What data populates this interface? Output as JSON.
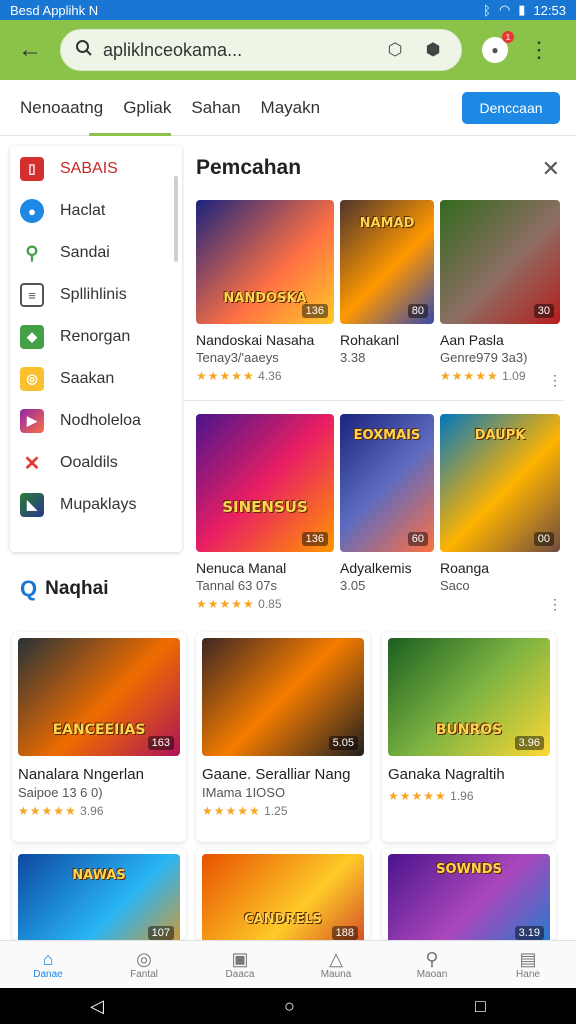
{
  "status": {
    "left": "Besd Applihk  N",
    "time": "12:53"
  },
  "topbar": {
    "search_value": "apliklnceokama..."
  },
  "tabs": {
    "items": [
      "Nenoaatng",
      "Gpliak",
      "Sahan",
      "Mayakn"
    ],
    "button": "Denccaan"
  },
  "sidebar": {
    "items": [
      {
        "label": "SABAIS",
        "color": "#d32f2f",
        "icon": "phone"
      },
      {
        "label": "Haclat",
        "color": "#1e88e5",
        "icon": "location"
      },
      {
        "label": "Sandai",
        "color": "#43a047",
        "icon": "search"
      },
      {
        "label": "Spllihlinis",
        "color": "#555555",
        "icon": "document"
      },
      {
        "label": "Renorgan",
        "color": "#43a047",
        "icon": "tag"
      },
      {
        "label": "Saakan",
        "color": "#fbc02d",
        "icon": "coin"
      },
      {
        "label": "Nodholeloa",
        "color": "#8e24aa",
        "icon": "play"
      },
      {
        "label": "Ooaldils",
        "color": "#e53935",
        "icon": "tools"
      },
      {
        "label": "Mupaklays",
        "color": "#2e7d32",
        "icon": "flag"
      }
    ]
  },
  "panel": {
    "title": "Pemcahan",
    "row1": [
      {
        "name": "Nandoskai Nasaha",
        "sub": "Tenay3/'aaeys",
        "rating": "4.36",
        "badge": "136",
        "art": "NANDOSKA",
        "bg": "linear-gradient(135deg,#1a237e,#ff7043 60%,#ffca28)"
      },
      {
        "name": "Rohakanl",
        "sub": "3.38",
        "rating": "",
        "badge": "80",
        "art": "NAMAD",
        "bg": "linear-gradient(135deg,#4e342e,#ff9800 55%,#3949ab)"
      },
      {
        "name": "Aan Pasla",
        "sub": "Genre979 3a3)",
        "rating": "1.09",
        "badge": "30",
        "art": "",
        "bg": "linear-gradient(135deg,#33691e,#8d6e63 55%,#b71c1c)"
      }
    ],
    "row2": [
      {
        "name": "Nenuca Manal",
        "sub": "Tannal 63 07s",
        "rating": "0.85",
        "badge": "136",
        "art": "SINENSUS",
        "bg": "linear-gradient(135deg,#4a148c,#e91e63 50%,#ff9800)"
      },
      {
        "name": "Adyalkemis",
        "sub": "3.05",
        "rating": "",
        "badge": "60",
        "art": "EOXMAIS",
        "bg": "linear-gradient(135deg,#1a237e,#5c6bc0 50%,#ff7043)"
      },
      {
        "name": "Roanga",
        "sub": "Saco",
        "rating": "",
        "badge": "00",
        "art": "DAUPK",
        "bg": "linear-gradient(135deg,#0277bd,#ffb300 55%,#6d4c41)"
      }
    ]
  },
  "section": {
    "title": "Naqhai",
    "cards": [
      {
        "name": "Nanalara Nngerlan",
        "sub": "Saipoe 13 6 0)",
        "rating": "3.96",
        "badge": "163",
        "art": "EANCEEIIAS",
        "bg": "linear-gradient(135deg,#263238,#ef6c00 55%,#ad1457)"
      },
      {
        "name": "Gaane. Seralliar Nang",
        "sub": "IMama 1IOSO",
        "rating": "1.25",
        "badge": "5.05",
        "art": "",
        "bg": "linear-gradient(135deg,#3e2723,#f57c00 50%,#212121)"
      },
      {
        "name": "Ganaka Nagraltih",
        "sub": "",
        "rating": "1.96",
        "badge": "3.96",
        "art": "BUNROS",
        "bg": "linear-gradient(135deg,#1b5e20,#7cb342 50%,#fdd835)"
      },
      {
        "name": "",
        "sub": "",
        "rating": "",
        "badge": "107",
        "art": "NAWAS",
        "bg": "linear-gradient(135deg,#0d47a1,#29b6f6 55%,#ff8f00)"
      },
      {
        "name": "",
        "sub": "",
        "rating": "",
        "badge": "188",
        "art": "CANDRELS",
        "bg": "linear-gradient(135deg,#e65100,#ffca28 55%,#c62828)"
      },
      {
        "name": "",
        "sub": "",
        "rating": "",
        "badge": "3.19",
        "art": "SOWNDS",
        "bg": "linear-gradient(135deg,#4a148c,#ab47bc 50%,#0288d1)"
      }
    ]
  },
  "bottom_nav": [
    {
      "label": "Danae",
      "icon": "home"
    },
    {
      "label": "Fantal",
      "icon": "coin"
    },
    {
      "label": "Daaca",
      "icon": "box"
    },
    {
      "label": "Mauna",
      "icon": "up"
    },
    {
      "label": "Maoan",
      "icon": "search"
    },
    {
      "label": "Hane",
      "icon": "grid"
    }
  ]
}
